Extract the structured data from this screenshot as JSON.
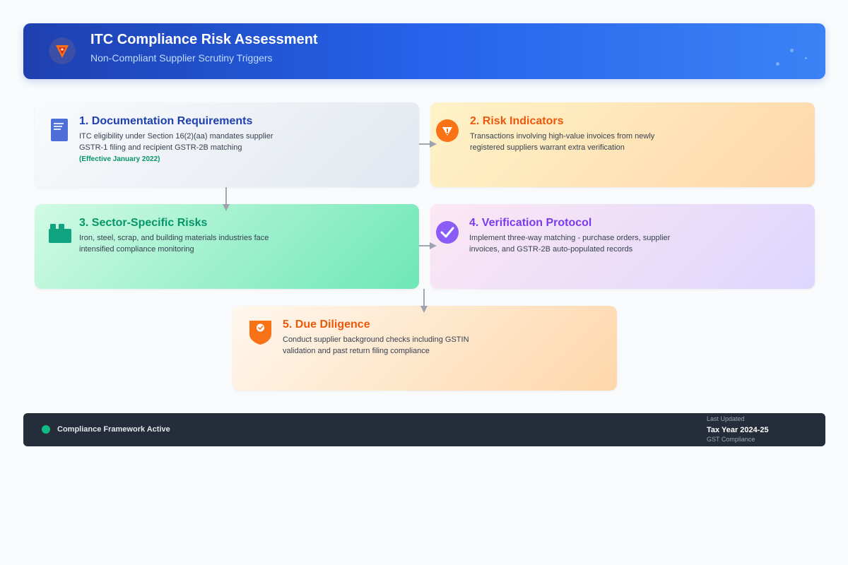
{
  "header": {
    "title": "ITC Compliance Risk Assessment",
    "subtitle": "Non-Compliant Supplier Scrutiny Triggers",
    "logo_icon": "warning-shield-icon",
    "gradient": [
      "#1e40af",
      "#3b82f6"
    ]
  },
  "steps": [
    {
      "title": "1. Documentation Requirements",
      "description": "ITC eligibility under Section 16(2)(aa) mandates supplier GSTR-1 filing and recipient GSTR-2B matching",
      "note": "(Effective January 2022)",
      "icon": "document-icon",
      "accent": "#1e40af"
    },
    {
      "title": "2. Risk Indicators",
      "description": "Transactions involving high-value invoices from newly registered suppliers warrant extra verification",
      "icon": "warning-icon",
      "accent": "#ea580c"
    },
    {
      "title": "3. Sector-Specific Risks",
      "description": "Iron, steel, scrap, and building materials industries face intensified compliance monitoring",
      "icon": "factory-icon",
      "accent": "#059669"
    },
    {
      "title": "4. Verification Protocol",
      "description": "Implement three-way matching - purchase orders, supplier invoices, and GSTR-2B auto-populated records",
      "icon": "check-circle-icon",
      "accent": "#7c3aed"
    },
    {
      "title": "5. Due Diligence",
      "description": "Conduct supplier background checks including GSTIN validation and past return filing compliance",
      "icon": "shield-check-icon",
      "accent": "#ea580c"
    }
  ],
  "footer": {
    "status": "Compliance Framework Active",
    "status_color": "#10b981",
    "updated_label": "Last Updated",
    "tax_year": "Tax Year 2024-25",
    "category": "GST Compliance"
  }
}
